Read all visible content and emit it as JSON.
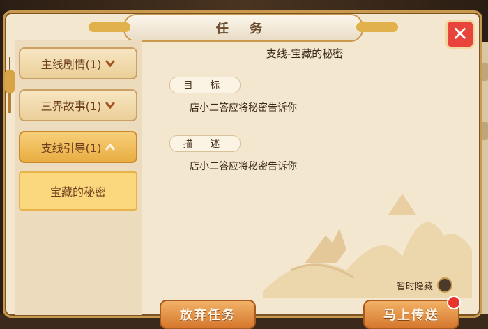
{
  "window": {
    "title": "任 务"
  },
  "sidebar": {
    "tabs": [
      {
        "label": "主线剧情(1)",
        "state": "collapsed"
      },
      {
        "label": "三界故事(1)",
        "state": "collapsed"
      },
      {
        "label": "支线引导(1)",
        "state": "expanded"
      }
    ],
    "subitems": [
      {
        "label": "宝藏的秘密"
      }
    ]
  },
  "quest": {
    "title": "支线-宝藏的秘密",
    "objective_label": "目 标",
    "objective_text": "店小二答应将秘密告诉你",
    "description_label": "描 述",
    "description_text": "店小二答应将秘密告诉你"
  },
  "controls": {
    "hide_label": "暂时隐藏",
    "abandon_button": "放弃任务",
    "teleport_button": "马上传送"
  },
  "colors": {
    "accent": "#d6782e",
    "panel": "#f3e7cf",
    "highlight": "#fbd77e",
    "alert": "#e8352c"
  },
  "icons": [
    "close-icon",
    "chevron-down-icon",
    "chevron-up-icon",
    "lantern-icon"
  ]
}
